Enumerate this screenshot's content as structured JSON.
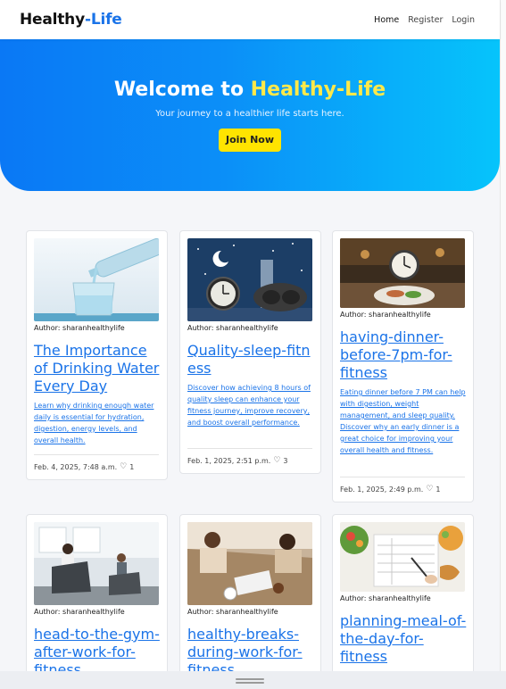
{
  "navbar": {
    "brand_part1": "Healthy",
    "brand_part2": "-Life",
    "links": [
      "Home",
      "Register",
      "Login"
    ]
  },
  "hero": {
    "title_part1": "Welcome to ",
    "title_part2": "Healthy-Life",
    "subtitle": "Your journey to a healthier life starts here.",
    "button_label": "Join Now"
  },
  "posts": [
    {
      "author": "Author: sharanhealthylife",
      "title": "The Importance of Drinking Water Every Day",
      "description": "Learn why drinking enough water daily is essential for hydration, digestion, energy levels, and overall health.",
      "date": "Feb. 4, 2025, 7:48 a.m.",
      "likes": "1",
      "image_icon": "water-glass-image"
    },
    {
      "author": "Author: sharanhealthylife",
      "title": "Quality-sleep-fitness",
      "description": "Discover how achieving 8 hours of quality sleep can enhance your fitness journey, improve recovery, and boost overall performance.",
      "date": "Feb. 1, 2025, 2:51 p.m.",
      "likes": "3",
      "image_icon": "alarm-clock-sleep-mask-image"
    },
    {
      "author": "Author: sharanhealthylife",
      "title": "having-dinner-before-7pm-for-fitness",
      "description": "Eating dinner before 7 PM can help with digestion, weight management, and sleep quality. Discover why an early dinner is a great choice for improving your overall health and fitness.",
      "date": "Feb. 1, 2025, 2:49 p.m.",
      "likes": "1",
      "image_icon": "dinner-clock-image"
    },
    {
      "author": "Author: sharanhealthylife",
      "title": "head-to-the-gym-after-work-for-fitness",
      "image_icon": "gym-treadmill-image"
    },
    {
      "author": "Author: sharanhealthylife",
      "title": "healthy-breaks-during-work-for-fitness",
      "image_icon": "work-break-desk-image"
    },
    {
      "author": "Author: sharanhealthylife",
      "title": "planning-meal-of-the-day-for-fitness",
      "image_icon": "meal-planning-image"
    }
  ],
  "colors": {
    "brand_accent": "#1a73e8",
    "hero_gradient_start": "#0a78f5",
    "hero_gradient_end": "#06c4fb",
    "highlight_yellow": "#ffe94a",
    "button_yellow": "#ffe400"
  }
}
